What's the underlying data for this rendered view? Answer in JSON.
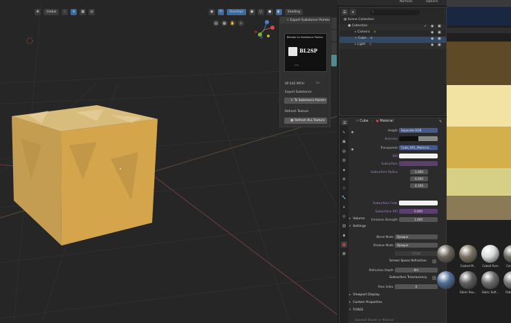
{
  "top_menu": {
    "normals": "Normals",
    "options": "Options"
  },
  "viewport": {
    "transform_orientation": "Global",
    "overlays_label": "Overlays",
    "shading_label": "Shading"
  },
  "npanel": {
    "title": "Export Substance Painter",
    "logo_heading": "Blender to Substance Painter",
    "logo_text": "BL2SP",
    "logo_sub": "",
    "logo_url": "[url]",
    "exe_path_label": "SP EXE PATH",
    "export_label": "Export Substance",
    "to_sp_button": "To Substance Painter",
    "refresh_texture": "Refresh Texture",
    "refresh_all_button": "Refresh ALL Texture"
  },
  "outliner": {
    "search_placeholder": "",
    "rows": [
      {
        "name": "Scene Collection"
      },
      {
        "name": "Collection"
      },
      {
        "name": "Camera"
      },
      {
        "name": "Cube"
      },
      {
        "name": "Light"
      }
    ]
  },
  "properties": {
    "object_name": "Cube",
    "material_tab": "Material",
    "rows": [
      {
        "label": "Height",
        "value": "Separate RGB",
        "style": "blue"
      },
      {
        "label": "Emissive",
        "value": "",
        "style": "dark"
      },
      {
        "label": "Transparent",
        "value": "Cube_001_Material...",
        "style": "blue"
      },
      {
        "label": "IOR",
        "value": "",
        "style": "white"
      },
      {
        "label": "Subsurface",
        "value": "",
        "style": "purple"
      }
    ],
    "subsurface_radius_label": "Subsurface Radius",
    "subsurface_radius": [
      "1.000",
      "0.200",
      "0.100"
    ],
    "rows2": [
      {
        "label": "Subsurface Color",
        "value": "",
        "style": "white"
      },
      {
        "label": "Subsurface IOR",
        "value": "0.000",
        "style": "purple"
      },
      {
        "label": "Emission Strength",
        "value": "1.000",
        "style": "dark"
      }
    ],
    "sections": {
      "volume": "Volume",
      "settings": "Settings",
      "viewport_display": "Viewport Display",
      "custom_properties": "Custom Properties",
      "three": "THREE"
    },
    "settings": {
      "blend_mode_label": "Blend Mode",
      "blend_mode_value": "Opaque",
      "shadow_mode_label": "Shadow Mode",
      "shadow_mode_value": "Opaque",
      "clip_value": "0.500",
      "screen_space_refraction": "Screen Space Refraction",
      "refraction_depth_label": "Refraction Depth",
      "refraction_depth_value": "0m",
      "subsurface_translucency": "Subsurface Translucency",
      "pass_index_label": "Pass Index",
      "pass_index_value": "0"
    },
    "footer_text": "Selected Shader is: Material"
  },
  "right_panel": {
    "materials": [
      {
        "name": "",
        "color": "#6a6258"
      },
      {
        "name": "Coated M...",
        "color": "#7d7263"
      },
      {
        "name": "Cobalt Pure",
        "color": "#d8dadb"
      },
      {
        "name": "Concrete",
        "color": "#6e6a64"
      },
      {
        "name": "",
        "color": "#4f6f96"
      },
      {
        "name": "Fabric Rou...",
        "color": "#5e5e5e"
      },
      {
        "name": "Fabric Soft...",
        "color": "#6b6b6b"
      },
      {
        "name": "Fabric S...",
        "color": "#777777"
      }
    ],
    "stripe_colors": [
      "#5e4a26",
      "#f3e3a2",
      "#d4b04c",
      "#d6cf86",
      "#8a7a55"
    ]
  },
  "colors": {
    "cube_top": "#d9b871",
    "cube_left": "#c9a45a",
    "cube_right": "#d7a94f",
    "selected_row": "#334766",
    "accent_purple": "#5c3e6f"
  }
}
